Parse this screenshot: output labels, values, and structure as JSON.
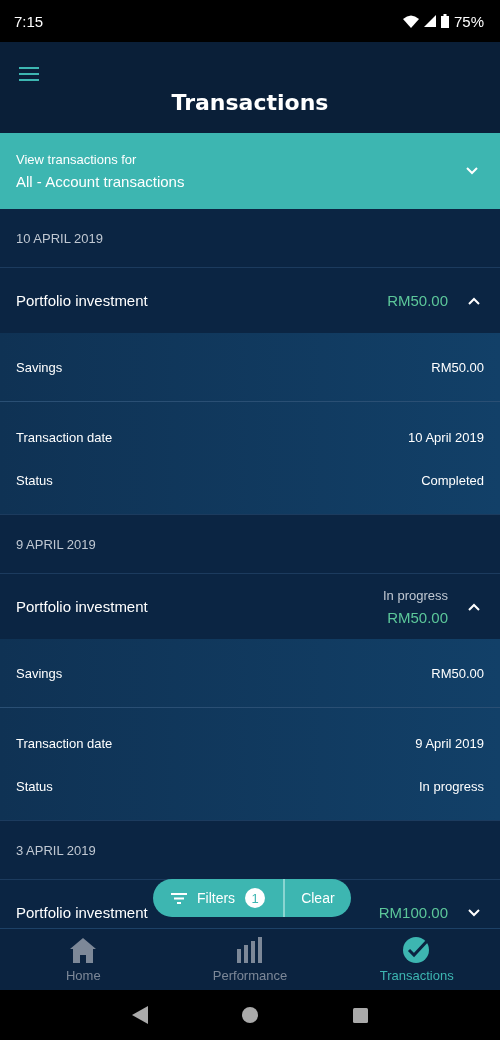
{
  "status_bar": {
    "time": "7:15",
    "battery": "75%"
  },
  "header": {
    "title": "Transactions"
  },
  "account_selector": {
    "label": "View transactions for",
    "value": "All - Account transactions"
  },
  "groups": [
    {
      "date": "10 APRIL 2019",
      "title": "Portfolio investment",
      "amount": "RM50.00",
      "expanded": true,
      "details": [
        {
          "label": "Savings",
          "value": "RM50.00"
        }
      ],
      "info": [
        {
          "label": "Transaction date",
          "value": "10 April 2019"
        },
        {
          "label": "Status",
          "value": "Completed"
        }
      ]
    },
    {
      "date": "9 APRIL 2019",
      "title": "Portfolio investment",
      "status_note": "In progress",
      "amount": "RM50.00",
      "expanded": true,
      "details": [
        {
          "label": "Savings",
          "value": "RM50.00"
        }
      ],
      "info": [
        {
          "label": "Transaction date",
          "value": "9 April 2019"
        },
        {
          "label": "Status",
          "value": "In progress"
        }
      ]
    },
    {
      "date": "3 APRIL 2019",
      "title": "Portfolio investment",
      "amount": "RM100.00",
      "expanded": false
    }
  ],
  "filter_bar": {
    "label": "Filters",
    "count": "1",
    "clear": "Clear"
  },
  "bottom_nav": [
    {
      "label": "Home",
      "selected": false
    },
    {
      "label": "Performance",
      "selected": false
    },
    {
      "label": "Transactions",
      "selected": true
    }
  ]
}
